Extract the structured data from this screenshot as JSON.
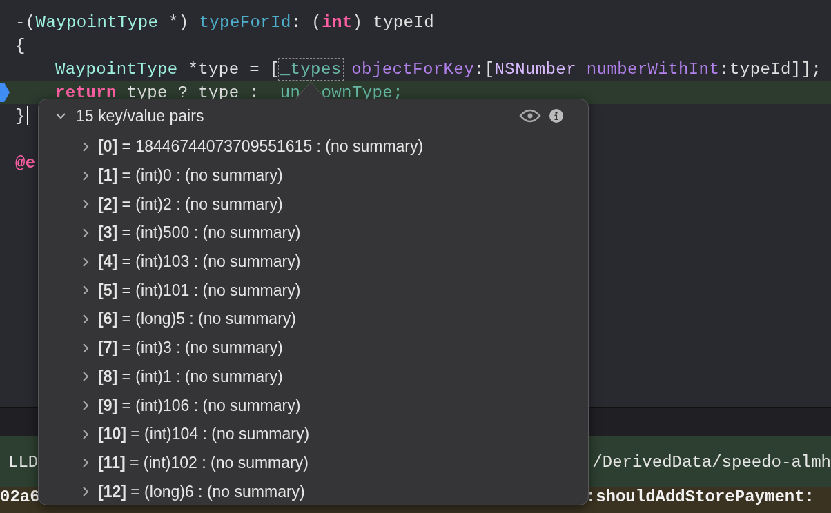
{
  "editor": {
    "lines": [
      {
        "current": false,
        "breakpoint": false,
        "cursor": false,
        "tokens": [
          {
            "text": "-(",
            "kind": "plain"
          },
          {
            "text": "WaypointType",
            "kind": "type"
          },
          {
            "text": " *) ",
            "kind": "plain"
          },
          {
            "text": "typeForId",
            "kind": "decl"
          },
          {
            "text": ": (",
            "kind": "plain"
          },
          {
            "text": "int",
            "kind": "keyword"
          },
          {
            "text": ") typeId",
            "kind": "plain"
          }
        ]
      },
      {
        "current": false,
        "breakpoint": false,
        "cursor": false,
        "tokens": [
          {
            "text": "{",
            "kind": "plain"
          }
        ]
      },
      {
        "current": false,
        "breakpoint": false,
        "cursor": false,
        "indented": true,
        "tokens": [
          {
            "text": "WaypointType",
            "kind": "type"
          },
          {
            "text": " *type = [",
            "kind": "plain"
          },
          {
            "text": "_types",
            "kind": "ivar-focus"
          },
          {
            "text": " objectForKey",
            "kind": "method"
          },
          {
            "text": ":[",
            "kind": "plain"
          },
          {
            "text": "NSNumber ",
            "kind": "sysclass"
          },
          {
            "text": "numberWithInt",
            "kind": "method"
          },
          {
            "text": ":typeId]];",
            "kind": "plain"
          }
        ]
      },
      {
        "current": true,
        "breakpoint": true,
        "cursor": false,
        "indented": true,
        "tokens": [
          {
            "text": "return",
            "kind": "keyword"
          },
          {
            "text": " type ? type :  ",
            "kind": "plain"
          },
          {
            "text": "un",
            "kind": "ivar"
          },
          {
            "text": "ownType;",
            "kind": "ivar",
            "covered_before": true
          }
        ]
      },
      {
        "current": false,
        "breakpoint": false,
        "cursor": true,
        "tokens": [
          {
            "text": "}",
            "kind": "plain"
          }
        ]
      },
      {
        "current": false,
        "breakpoint": false,
        "cursor": false
      },
      {
        "current": false,
        "breakpoint": false,
        "cursor": false,
        "tokens": [
          {
            "text": "@e",
            "kind": "keyword"
          }
        ]
      }
    ]
  },
  "debug_bar": {
    "label": "LLD",
    "path": "/DerivedData/speedo-almh"
  },
  "console": {
    "visible_parts": [
      "02a6",
      ":shouldAddStorePayment:"
    ]
  },
  "popover": {
    "title": "15 key/value pairs",
    "expanded": true,
    "rows": [
      {
        "index": "[0]",
        "value": " = 18446744073709551615 : (no summary)",
        "expanded": false
      },
      {
        "index": "[1]",
        "value": " = (int)0 : (no summary)",
        "expanded": false
      },
      {
        "index": "[2]",
        "value": " = (int)2 : (no summary)",
        "expanded": false
      },
      {
        "index": "[3]",
        "value": " = (int)500 : (no summary)",
        "expanded": false
      },
      {
        "index": "[4]",
        "value": " = (int)103 : (no summary)",
        "expanded": false
      },
      {
        "index": "[5]",
        "value": " = (int)101 : (no summary)",
        "expanded": false
      },
      {
        "index": "[6]",
        "value": " = (long)5 : (no summary)",
        "expanded": false
      },
      {
        "index": "[7]",
        "value": " = (int)3 : (no summary)",
        "expanded": false
      },
      {
        "index": "[8]",
        "value": " = (int)1 : (no summary)",
        "expanded": false
      },
      {
        "index": "[9]",
        "value": " = (int)106 : (no summary)",
        "expanded": false
      },
      {
        "index": "[10]",
        "value": " = (int)104 : (no summary)",
        "expanded": false
      },
      {
        "index": "[11]",
        "value": " = (int)102 : (no summary)",
        "expanded": false
      },
      {
        "index": "[12]",
        "value": " = (long)6 : (no summary)",
        "expanded": false
      }
    ]
  }
}
